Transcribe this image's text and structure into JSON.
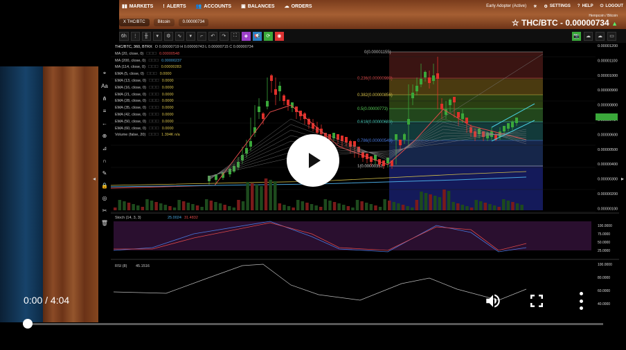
{
  "video": {
    "time_display": "0:00 / 4:04",
    "progress": 0.0
  },
  "nav": {
    "items": [
      {
        "icon": "bar-chart-icon",
        "label": "MARKETS"
      },
      {
        "icon": "alert-icon",
        "label": "ALERTS"
      },
      {
        "icon": "users-icon",
        "label": "ACCOUNTS"
      },
      {
        "icon": "wallet-icon",
        "label": "BALANCES"
      },
      {
        "icon": "cloud-icon",
        "label": "ORDERS"
      }
    ],
    "right": {
      "status": "Early Adopter (Active)",
      "settings": "SETTINGS",
      "help": "HELP",
      "logout": "LOGOUT"
    }
  },
  "tabs": [
    {
      "label": "X THC/BTC",
      "active": true
    },
    {
      "label": "Bitcoin",
      "active": false
    },
    {
      "label": "0.00000734",
      "active": false
    }
  ],
  "pair": {
    "subtitle": "Hempcoin / Bitcoin",
    "title": "THC/BTC - 0.00000734",
    "direction": "up"
  },
  "toolbar": {
    "interval": "6h"
  },
  "header_row": {
    "symbol": "THC/BTC, 360, BTRX",
    "ohlc": "O 0.00000719 H 0.00000743 L 0.00000715 C 0.00000734"
  },
  "indicators": [
    {
      "name": "MA (20, close, 0)",
      "value": "0.00000548",
      "color": "red"
    },
    {
      "name": "MA (200, close, 0)",
      "value": "0.00000237",
      "color": "blue"
    },
    {
      "name": "MA (114, close, 0)",
      "value": "0.00000283",
      "color": "yellow"
    },
    {
      "name": "EMA (5, close, 0)",
      "value": "0.0000",
      "color": "yellow"
    },
    {
      "name": "EMA (13, close, 0)",
      "value": "0.0000",
      "color": "yellow"
    },
    {
      "name": "EMA (16, close, 0)",
      "value": "0.0000",
      "color": "yellow"
    },
    {
      "name": "EMA (21, close, 0)",
      "value": "0.0000",
      "color": "yellow"
    },
    {
      "name": "EMA (28, close, 0)",
      "value": "0.0000",
      "color": "yellow"
    },
    {
      "name": "EMA (35, close, 0)",
      "value": "0.0000",
      "color": "yellow"
    },
    {
      "name": "EMA (42, close, 0)",
      "value": "0.0000",
      "color": "yellow"
    },
    {
      "name": "EMA (50, close, 0)",
      "value": "0.0000",
      "color": "yellow"
    },
    {
      "name": "EMA (60, close, 0)",
      "value": "0.0000",
      "color": "yellow"
    },
    {
      "name": "Volume (false, 20)",
      "value": "1.394K n/a",
      "color": "yellow"
    }
  ],
  "fib_levels": [
    {
      "label": "0(0.00001155)"
    },
    {
      "label": "0.236(0.00000980)"
    },
    {
      "label": "0.382(0.00000856)"
    },
    {
      "label": "0.5(0.00000773)"
    },
    {
      "label": "0.618(0.00000681)"
    },
    {
      "label": "0.786(0.00000549)"
    },
    {
      "label": "1(0.00000351)"
    }
  ],
  "price_axis": [
    "0.00001200",
    "0.00001100",
    "0.00001000",
    "0.00000900",
    "0.00000800",
    "0.00000734",
    "0.00000600",
    "0.00000500",
    "0.00000400",
    "0.00000300",
    "0.00000200",
    "0.00000100"
  ],
  "stoch": {
    "label": "Stoch (14, 3, 3)",
    "v1": "25.0024",
    "v2": "31.4832",
    "axis": [
      "100.0000",
      "75.0000",
      "50.0000",
      "25.0000"
    ]
  },
  "rsi": {
    "label": "RSI (8)",
    "value": "45.1516",
    "axis": [
      "100.0000",
      "80.0000",
      "60.0000",
      "40.0000"
    ]
  },
  "colors": {
    "up": "#3aa83a",
    "down": "#e0302a",
    "accent": "#5ad15a"
  }
}
